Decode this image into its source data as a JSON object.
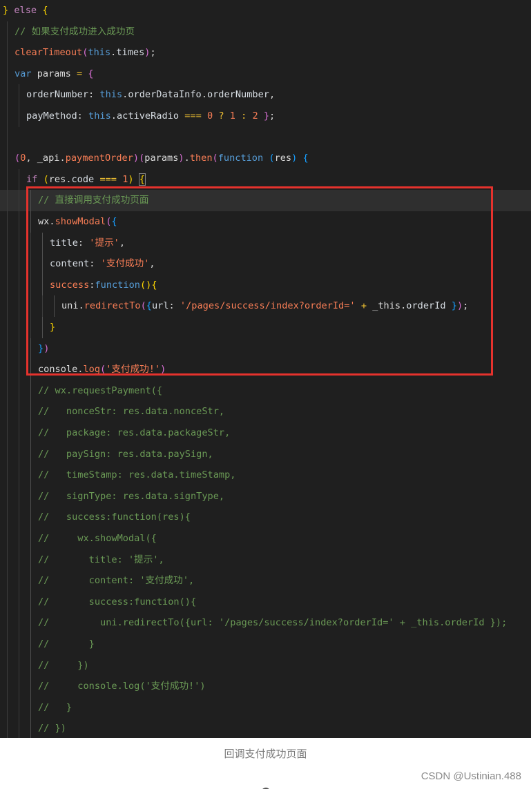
{
  "editor": {
    "theme_colors": {
      "background": "#1f1f1f",
      "keyword": "#569cd6",
      "control": "#c586c0",
      "function": "#f97e56",
      "string": "#f97e56",
      "comment": "#6a9955",
      "operator": "#f1c232",
      "highlight_box": "#e5322d"
    },
    "current_line_index": 9,
    "highlight_box": {
      "first_line_index": 9,
      "last_line_index": 16
    },
    "lines": [
      {
        "indent": 0,
        "tokens": [
          [
            "br1",
            "}"
          ],
          [
            "punc",
            " "
          ],
          [
            "ctl",
            "else"
          ],
          [
            "punc",
            " "
          ],
          [
            "br1",
            "{"
          ]
        ]
      },
      {
        "indent": 1,
        "tokens": [
          [
            "com",
            "// 如果支付成功进入成功页"
          ]
        ]
      },
      {
        "indent": 1,
        "tokens": [
          [
            "fn",
            "clearTimeout"
          ],
          [
            "br2",
            "("
          ],
          [
            "kw",
            "this"
          ],
          [
            "punc",
            "."
          ],
          [
            "prop",
            "times"
          ],
          [
            "br2",
            ")"
          ],
          [
            "punc",
            ";"
          ]
        ]
      },
      {
        "indent": 1,
        "tokens": [
          [
            "kw",
            "var"
          ],
          [
            "punc",
            " "
          ],
          [
            "var",
            "params"
          ],
          [
            "punc",
            " "
          ],
          [
            "op",
            "="
          ],
          [
            "punc",
            " "
          ],
          [
            "br2",
            "{"
          ]
        ]
      },
      {
        "indent": 2,
        "tokens": [
          [
            "prop",
            "orderNumber"
          ],
          [
            "punc",
            ": "
          ],
          [
            "kw",
            "this"
          ],
          [
            "punc",
            "."
          ],
          [
            "prop",
            "orderDataInfo"
          ],
          [
            "punc",
            "."
          ],
          [
            "prop",
            "orderNumber"
          ],
          [
            "punc",
            ","
          ]
        ]
      },
      {
        "indent": 2,
        "tokens": [
          [
            "prop",
            "payMethod"
          ],
          [
            "punc",
            ": "
          ],
          [
            "kw",
            "this"
          ],
          [
            "punc",
            "."
          ],
          [
            "prop",
            "activeRadio"
          ],
          [
            "punc",
            " "
          ],
          [
            "op",
            "==="
          ],
          [
            "punc",
            " "
          ],
          [
            "num",
            "0"
          ],
          [
            "punc",
            " "
          ],
          [
            "op",
            "?"
          ],
          [
            "punc",
            " "
          ],
          [
            "num",
            "1"
          ],
          [
            "punc",
            " "
          ],
          [
            "op",
            ":"
          ],
          [
            "punc",
            " "
          ],
          [
            "num",
            "2"
          ],
          [
            "punc",
            " "
          ],
          [
            "br2",
            "}"
          ],
          [
            "punc",
            ";"
          ]
        ]
      },
      {
        "indent": 1,
        "tokens": []
      },
      {
        "indent": 1,
        "tokens": [
          [
            "br2",
            "("
          ],
          [
            "num",
            "0"
          ],
          [
            "punc",
            ", "
          ],
          [
            "var",
            "_api"
          ],
          [
            "punc",
            "."
          ],
          [
            "fn",
            "paymentOrder"
          ],
          [
            "br2",
            ")"
          ],
          [
            "br2",
            "("
          ],
          [
            "var",
            "params"
          ],
          [
            "br2",
            ")"
          ],
          [
            "punc",
            "."
          ],
          [
            "fn",
            "then"
          ],
          [
            "br2",
            "("
          ],
          [
            "kw",
            "function"
          ],
          [
            "punc",
            " "
          ],
          [
            "br3",
            "("
          ],
          [
            "var",
            "res"
          ],
          [
            "br3",
            ")"
          ],
          [
            "punc",
            " "
          ],
          [
            "br3",
            "{"
          ]
        ]
      },
      {
        "indent": 2,
        "tokens": [
          [
            "ctl",
            "if"
          ],
          [
            "punc",
            " "
          ],
          [
            "br1",
            "("
          ],
          [
            "var",
            "res"
          ],
          [
            "punc",
            "."
          ],
          [
            "prop",
            "code"
          ],
          [
            "punc",
            " "
          ],
          [
            "op",
            "==="
          ],
          [
            "punc",
            " "
          ],
          [
            "num",
            "1"
          ],
          [
            "br1",
            ")"
          ],
          [
            "punc",
            " "
          ],
          [
            "br1m",
            "{"
          ]
        ]
      },
      {
        "indent": 3,
        "tokens": [
          [
            "com",
            "// 直接调用支付成功页面"
          ]
        ]
      },
      {
        "indent": 3,
        "tokens": [
          [
            "var",
            "wx"
          ],
          [
            "punc",
            "."
          ],
          [
            "fn",
            "showModal"
          ],
          [
            "br2",
            "("
          ],
          [
            "br3",
            "{"
          ]
        ]
      },
      {
        "indent": 4,
        "tokens": [
          [
            "prop",
            "title"
          ],
          [
            "punc",
            ": "
          ],
          [
            "str",
            "'提示'"
          ],
          [
            "punc",
            ","
          ]
        ]
      },
      {
        "indent": 4,
        "tokens": [
          [
            "prop",
            "content"
          ],
          [
            "punc",
            ": "
          ],
          [
            "str",
            "'支付成功'"
          ],
          [
            "punc",
            ","
          ]
        ]
      },
      {
        "indent": 4,
        "tokens": [
          [
            "fn",
            "success"
          ],
          [
            "punc",
            ":"
          ],
          [
            "kw",
            "function"
          ],
          [
            "br1",
            "()"
          ],
          [
            "br1",
            "{"
          ]
        ]
      },
      {
        "indent": 5,
        "tokens": [
          [
            "var",
            "uni"
          ],
          [
            "punc",
            "."
          ],
          [
            "fn",
            "redirectTo"
          ],
          [
            "br2",
            "("
          ],
          [
            "br3",
            "{"
          ],
          [
            "prop",
            "url"
          ],
          [
            "punc",
            ": "
          ],
          [
            "str",
            "'/pages/success/index?orderId='"
          ],
          [
            "punc",
            " "
          ],
          [
            "op",
            "+"
          ],
          [
            "punc",
            " "
          ],
          [
            "var",
            "_this"
          ],
          [
            "punc",
            "."
          ],
          [
            "prop",
            "orderId"
          ],
          [
            "punc",
            " "
          ],
          [
            "br3",
            "}"
          ],
          [
            "br2",
            ")"
          ],
          [
            "punc",
            ";"
          ]
        ]
      },
      {
        "indent": 4,
        "tokens": [
          [
            "br1",
            "}"
          ]
        ]
      },
      {
        "indent": 3,
        "tokens": [
          [
            "br3",
            "}"
          ],
          [
            "br2",
            ")"
          ]
        ]
      },
      {
        "indent": 3,
        "tokens": [
          [
            "var",
            "console"
          ],
          [
            "punc",
            "."
          ],
          [
            "fn",
            "log"
          ],
          [
            "br2",
            "("
          ],
          [
            "str",
            "'支付成功!'"
          ],
          [
            "br2",
            ")"
          ]
        ]
      },
      {
        "indent": 3,
        "tokens": [
          [
            "com",
            "// wx.requestPayment({"
          ]
        ]
      },
      {
        "indent": 3,
        "tokens": [
          [
            "com",
            "//   nonceStr: res.data.nonceStr,"
          ]
        ]
      },
      {
        "indent": 3,
        "tokens": [
          [
            "com",
            "//   package: res.data.packageStr,"
          ]
        ]
      },
      {
        "indent": 3,
        "tokens": [
          [
            "com",
            "//   paySign: res.data.paySign,"
          ]
        ]
      },
      {
        "indent": 3,
        "tokens": [
          [
            "com",
            "//   timeStamp: res.data.timeStamp,"
          ]
        ]
      },
      {
        "indent": 3,
        "tokens": [
          [
            "com",
            "//   signType: res.data.signType,"
          ]
        ]
      },
      {
        "indent": 3,
        "tokens": [
          [
            "com",
            "//   success:function(res){"
          ]
        ]
      },
      {
        "indent": 3,
        "tokens": [
          [
            "com",
            "//     wx.showModal({"
          ]
        ]
      },
      {
        "indent": 3,
        "tokens": [
          [
            "com",
            "//       title: '提示',"
          ]
        ]
      },
      {
        "indent": 3,
        "tokens": [
          [
            "com",
            "//       content: '支付成功',"
          ]
        ]
      },
      {
        "indent": 3,
        "tokens": [
          [
            "com",
            "//       success:function(){"
          ]
        ]
      },
      {
        "indent": 3,
        "tokens": [
          [
            "com",
            "//         uni.redirectTo({url: '/pages/success/index?orderId=' + _this.orderId });"
          ]
        ]
      },
      {
        "indent": 3,
        "tokens": [
          [
            "com",
            "//       }"
          ]
        ]
      },
      {
        "indent": 3,
        "tokens": [
          [
            "com",
            "//     })"
          ]
        ]
      },
      {
        "indent": 3,
        "tokens": [
          [
            "com",
            "//     console.log('支付成功!')"
          ]
        ]
      },
      {
        "indent": 3,
        "tokens": [
          [
            "com",
            "//   }"
          ]
        ]
      },
      {
        "indent": 3,
        "tokens": [
          [
            "com",
            "// })"
          ]
        ]
      }
    ]
  },
  "caption": "回调支付成功页面",
  "watermark": "CSDN @Ustinian.488",
  "bottom_icon": "chevron-icon"
}
